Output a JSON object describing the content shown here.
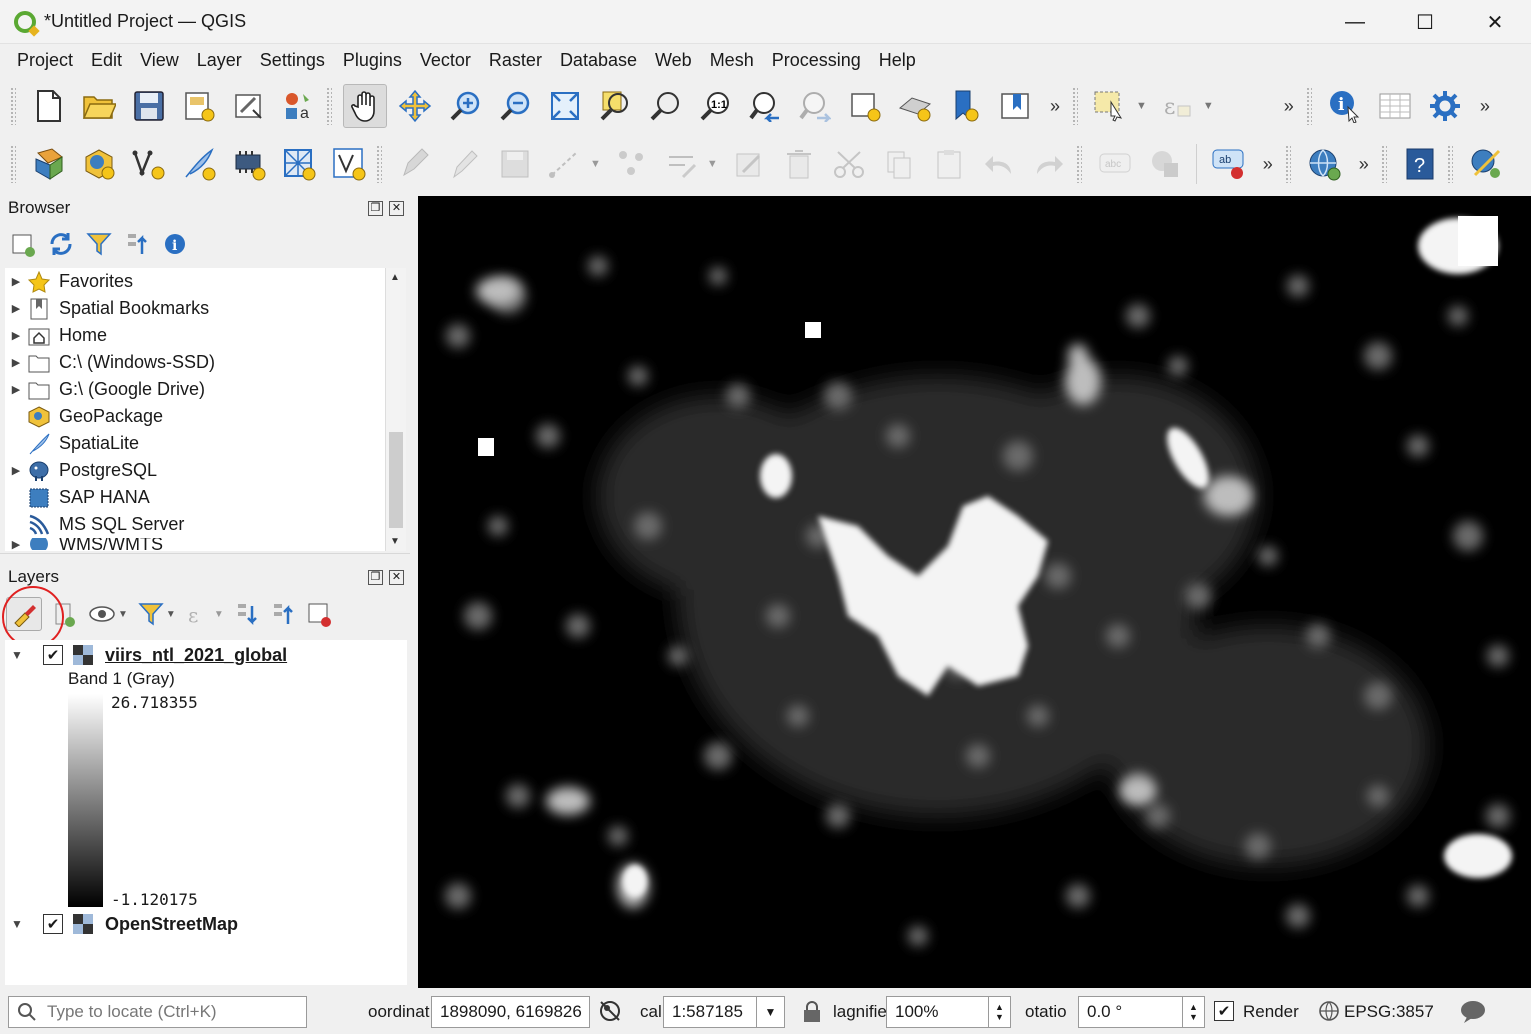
{
  "window": {
    "title": "*Untitled Project — QGIS",
    "minimize": "—",
    "maximize": "☐",
    "close": "✕"
  },
  "menubar": [
    "Project",
    "Edit",
    "View",
    "Layer",
    "Settings",
    "Plugins",
    "Vector",
    "Raster",
    "Database",
    "Web",
    "Mesh",
    "Processing",
    "Help"
  ],
  "toolbar_overflow": "»",
  "browser": {
    "title": "Browser",
    "items": [
      {
        "label": "Favorites",
        "icon": "star-icon"
      },
      {
        "label": "Spatial Bookmarks",
        "icon": "bookmark-icon"
      },
      {
        "label": "Home",
        "icon": "home-folder-icon"
      },
      {
        "label": "C:\\ (Windows-SSD)",
        "icon": "folder-icon"
      },
      {
        "label": "G:\\ (Google Drive)",
        "icon": "folder-icon"
      },
      {
        "label": "GeoPackage",
        "icon": "geopackage-icon"
      },
      {
        "label": "SpatiaLite",
        "icon": "feather-icon"
      },
      {
        "label": "PostgreSQL",
        "icon": "elephant-icon"
      },
      {
        "label": "SAP HANA",
        "icon": "hana-icon"
      },
      {
        "label": "MS SQL Server",
        "icon": "mssql-icon"
      },
      {
        "label": "WMS/WMTS",
        "icon": "globe-icon"
      }
    ]
  },
  "layers": {
    "title": "Layers",
    "items": [
      {
        "name": "viirs_ntl_2021_global",
        "checked": true,
        "band": "Band 1 (Gray)",
        "max": "26.718355",
        "min": "-1.120175"
      },
      {
        "name": "OpenStreetMap",
        "checked": true
      }
    ]
  },
  "statusbar": {
    "locator_placeholder": "Type to locate (Ctrl+K)",
    "coord_label": "oordinat",
    "coord_value": "1898090, 6169826",
    "scale_label": "cal",
    "scale_value": "1:587185",
    "magnifier_label": "lagnifie",
    "magnifier_value": "100%",
    "rotation_label": "otatio",
    "rotation_value": "0.0 °",
    "render_label": "Render",
    "render_checked": true,
    "crs": "EPSG:3857"
  },
  "colors": {
    "highlight_circle": "#e02020",
    "qgis_green": "#5aa832",
    "qgis_yellow": "#e6b31e",
    "toolbar_blue": "#2a6fc2"
  }
}
